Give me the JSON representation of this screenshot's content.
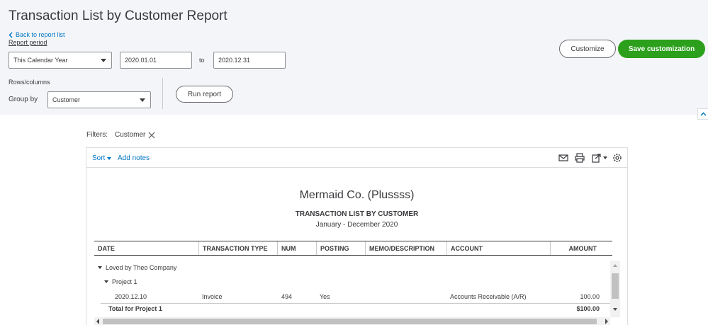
{
  "header": {
    "title": "Transaction List by Customer Report",
    "back_link": "Back to report list",
    "report_period_label": "Report period",
    "period_select": "This Calendar Year",
    "date_from": "2020.01.01",
    "to_label": "to",
    "date_to": "2020.12.31",
    "rows_columns_label": "Rows/columns",
    "group_by_label": "Group by",
    "group_by_select": "Customer",
    "run_report": "Run report",
    "customize": "Customize",
    "save_customization": "Save customization"
  },
  "filters": {
    "label": "Filters:",
    "chips": [
      "Customer"
    ]
  },
  "toolbar": {
    "sort": "Sort",
    "add_notes": "Add notes",
    "icons": [
      "email-icon",
      "print-icon",
      "export-icon",
      "settings-icon"
    ]
  },
  "report": {
    "company": "Mermaid Co. (Plussss)",
    "title": "TRANSACTION LIST BY CUSTOMER",
    "dates": "January - December 2020",
    "columns": [
      "DATE",
      "TRANSACTION TYPE",
      "NUM",
      "POSTING",
      "MEMO/DESCRIPTION",
      "ACCOUNT",
      "AMOUNT"
    ],
    "customer_group": "Loved by Theo Company",
    "project_group": "Project 1",
    "rows": [
      {
        "date": "2020.12.10",
        "type": "Invoice",
        "num": "494",
        "posting": "Yes",
        "memo": "",
        "account": "Accounts Receivable (A/R)",
        "amount": "100.00"
      }
    ],
    "total_label": "Total for Project 1",
    "total_amount": "$100.00"
  },
  "colors": {
    "accent_blue": "#0077c5",
    "green": "#2ca01c",
    "header_bg": "#f4f5f8"
  }
}
